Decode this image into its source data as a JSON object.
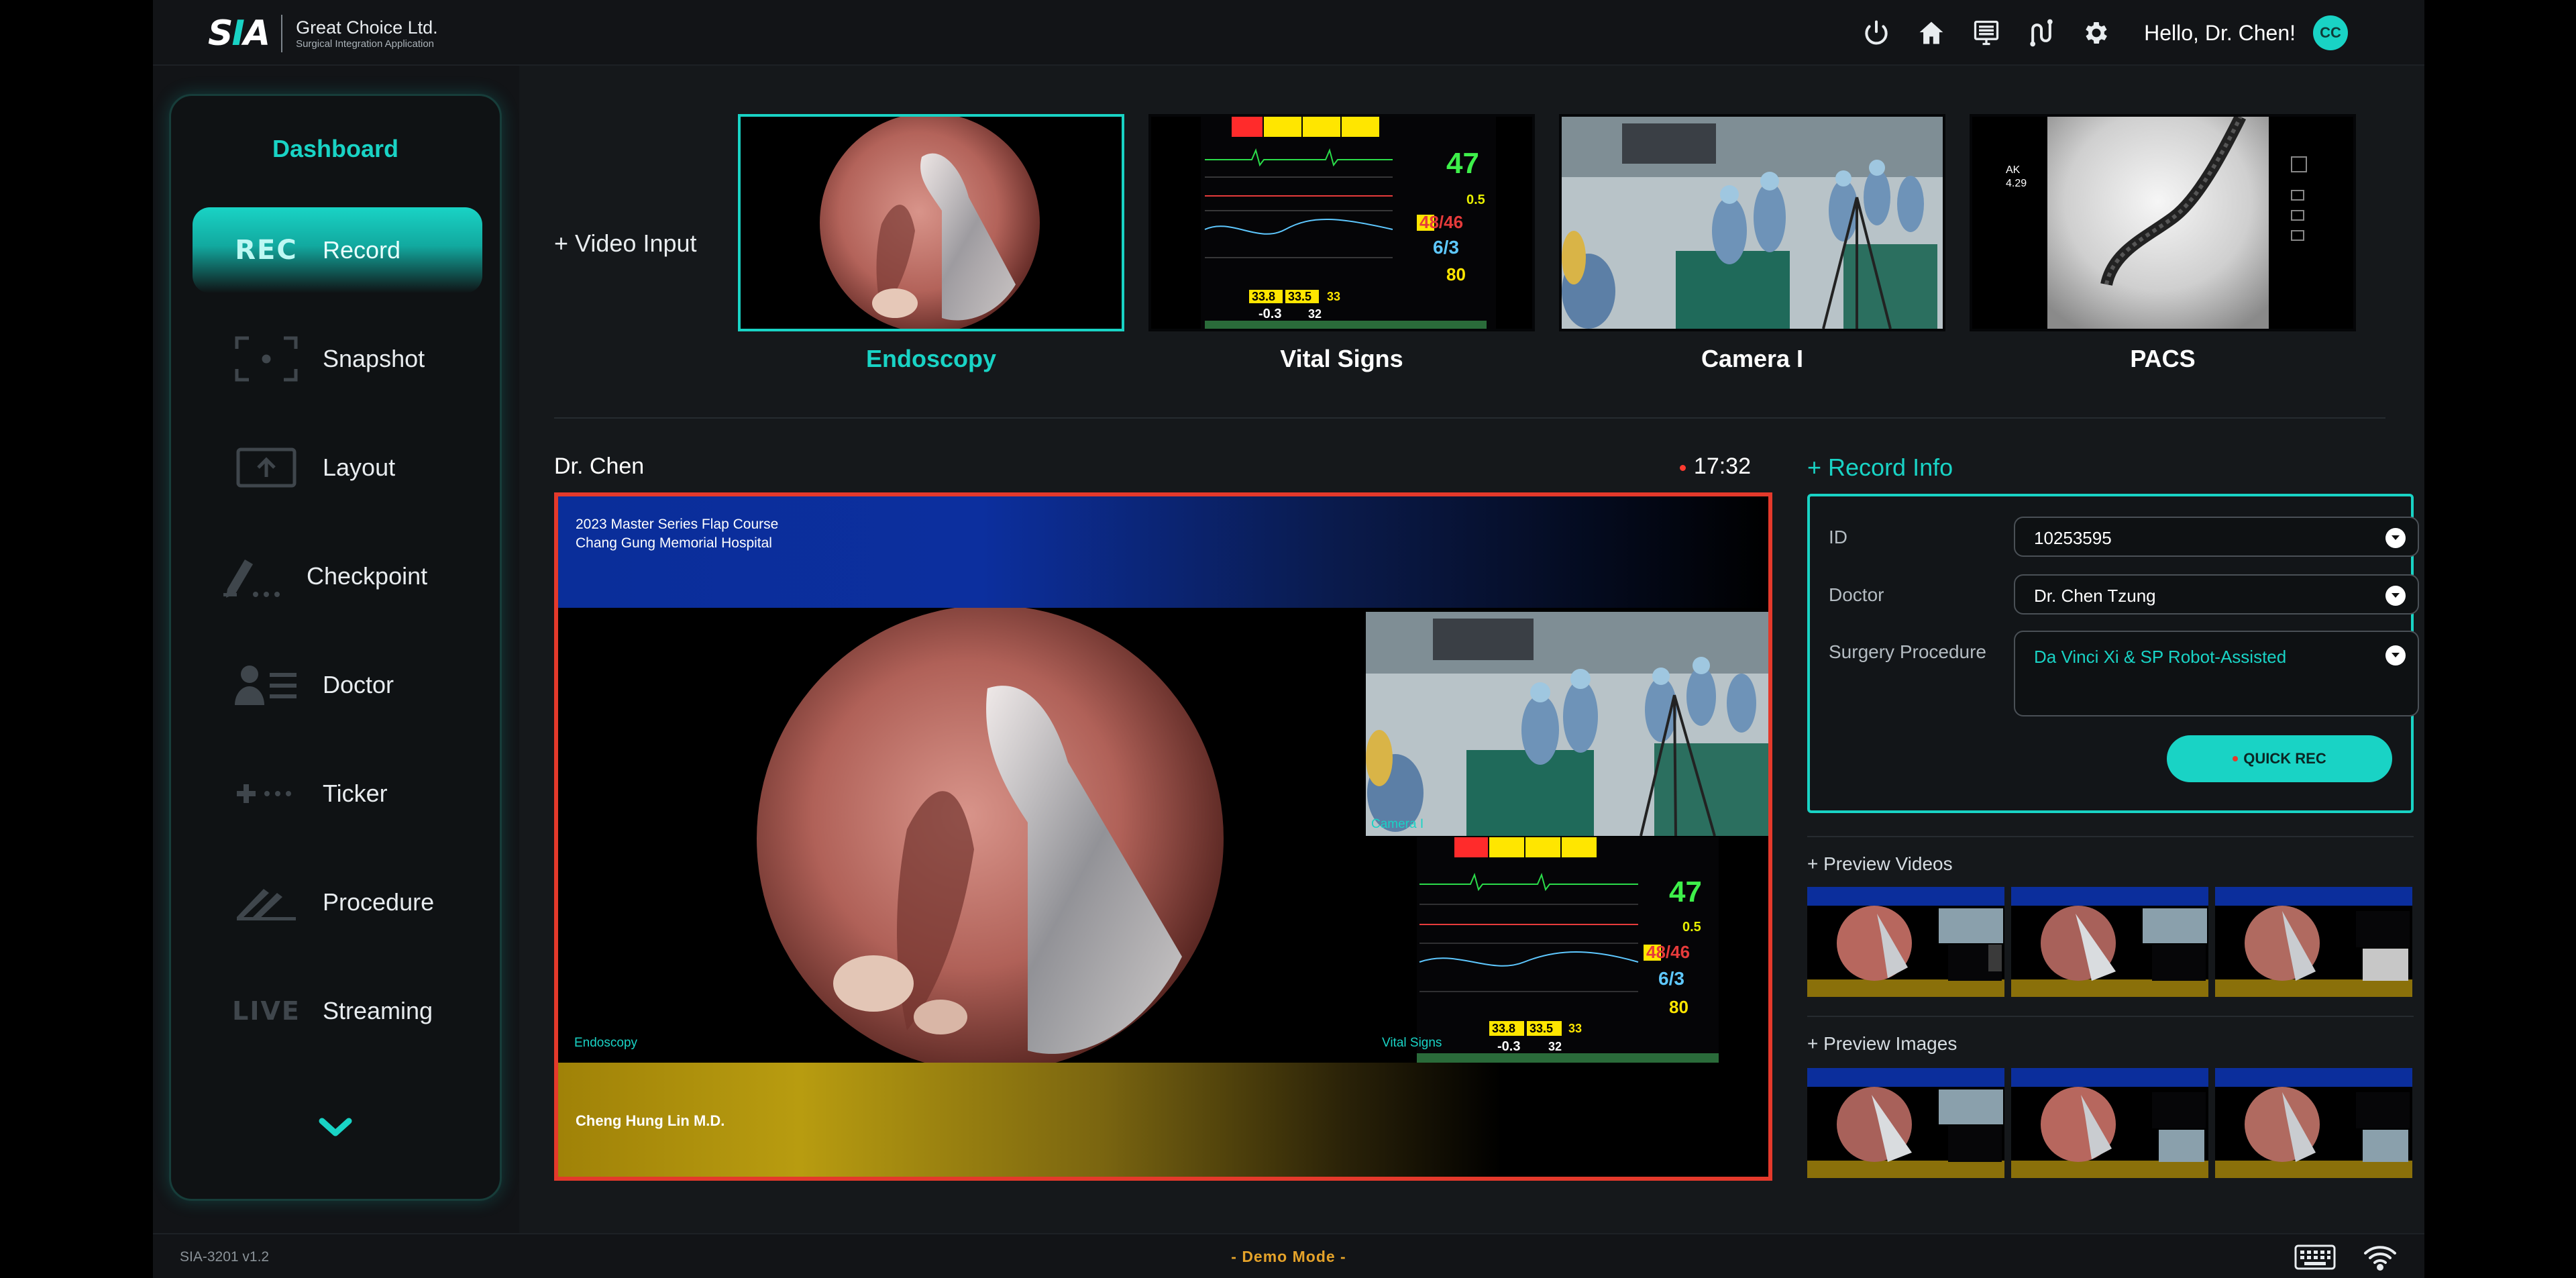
{
  "brand": {
    "logo_text": "SIA",
    "company": "Great Choice Ltd.",
    "subtitle": "Surgical Integration Application"
  },
  "header": {
    "icons": [
      "power-icon",
      "home-icon",
      "monitor-list-icon",
      "routing-icon",
      "gear-icon"
    ],
    "greeting": "Hello, Dr. Chen!",
    "avatar_initials": "CC"
  },
  "sidebar": {
    "title": "Dashboard",
    "items": [
      {
        "label": "Record",
        "icon": "rec-icon",
        "icon_text": "REC",
        "active": true
      },
      {
        "label": "Snapshot",
        "icon": "snapshot-icon"
      },
      {
        "label": "Layout",
        "icon": "layout-icon"
      },
      {
        "label": "Checkpoint",
        "icon": "checkpoint-icon"
      },
      {
        "label": "Doctor",
        "icon": "doctor-icon"
      },
      {
        "label": "Ticker",
        "icon": "ticker-icon"
      },
      {
        "label": "Procedure",
        "icon": "procedure-icon"
      },
      {
        "label": "Streaming",
        "icon": "live-icon",
        "icon_text": "LIVE"
      }
    ]
  },
  "sources": {
    "add_label": "+ Video Input",
    "items": [
      {
        "label": "Endoscopy",
        "selected": true
      },
      {
        "label": "Vital Signs"
      },
      {
        "label": "Camera I"
      },
      {
        "label": "PACS"
      }
    ]
  },
  "vitals": {
    "hr": "47",
    "spo2": "0.5",
    "bp": "48/46",
    "resp": "6/3",
    "pulse": "80",
    "temp1": "33.8",
    "temp2": "33.5",
    "temp3": "33",
    "et": "-0.3",
    "et2": "32"
  },
  "preview": {
    "operator": "Dr. Chen",
    "time": "17:32",
    "banner_line1": "2023 Master Series Flap Course",
    "banner_line2": "Chang Gung Memorial Hospital",
    "doctor_name": "Cheng Hung Lin M.D.",
    "captions": {
      "endoscopy": "Endoscopy",
      "camera": "Camera I",
      "vitals": "Vital Signs"
    }
  },
  "record_info": {
    "title": "+ Record Info",
    "fields": {
      "id_label": "ID",
      "id_value": "10253595",
      "doctor_label": "Doctor",
      "doctor_value": "Dr. Chen Tzung",
      "procedure_label": "Surgery Procedure",
      "procedure_value": "Da Vinci Xi & SP Robot-Assisted"
    },
    "quick_rec_label": "QUICK REC"
  },
  "preview_videos": {
    "title": "+ Preview Videos",
    "count": 3
  },
  "preview_images": {
    "title": "+ Preview Images",
    "count": 3
  },
  "footer": {
    "version": "SIA-3201 v1.2",
    "mode": "- Demo Mode -",
    "icons": [
      "keyboard-icon",
      "wifi-icon"
    ]
  },
  "colors": {
    "accent": "#19d3c5",
    "record_border": "#e4392b",
    "demo_mode": "#e5a32a",
    "background": "#121417"
  }
}
